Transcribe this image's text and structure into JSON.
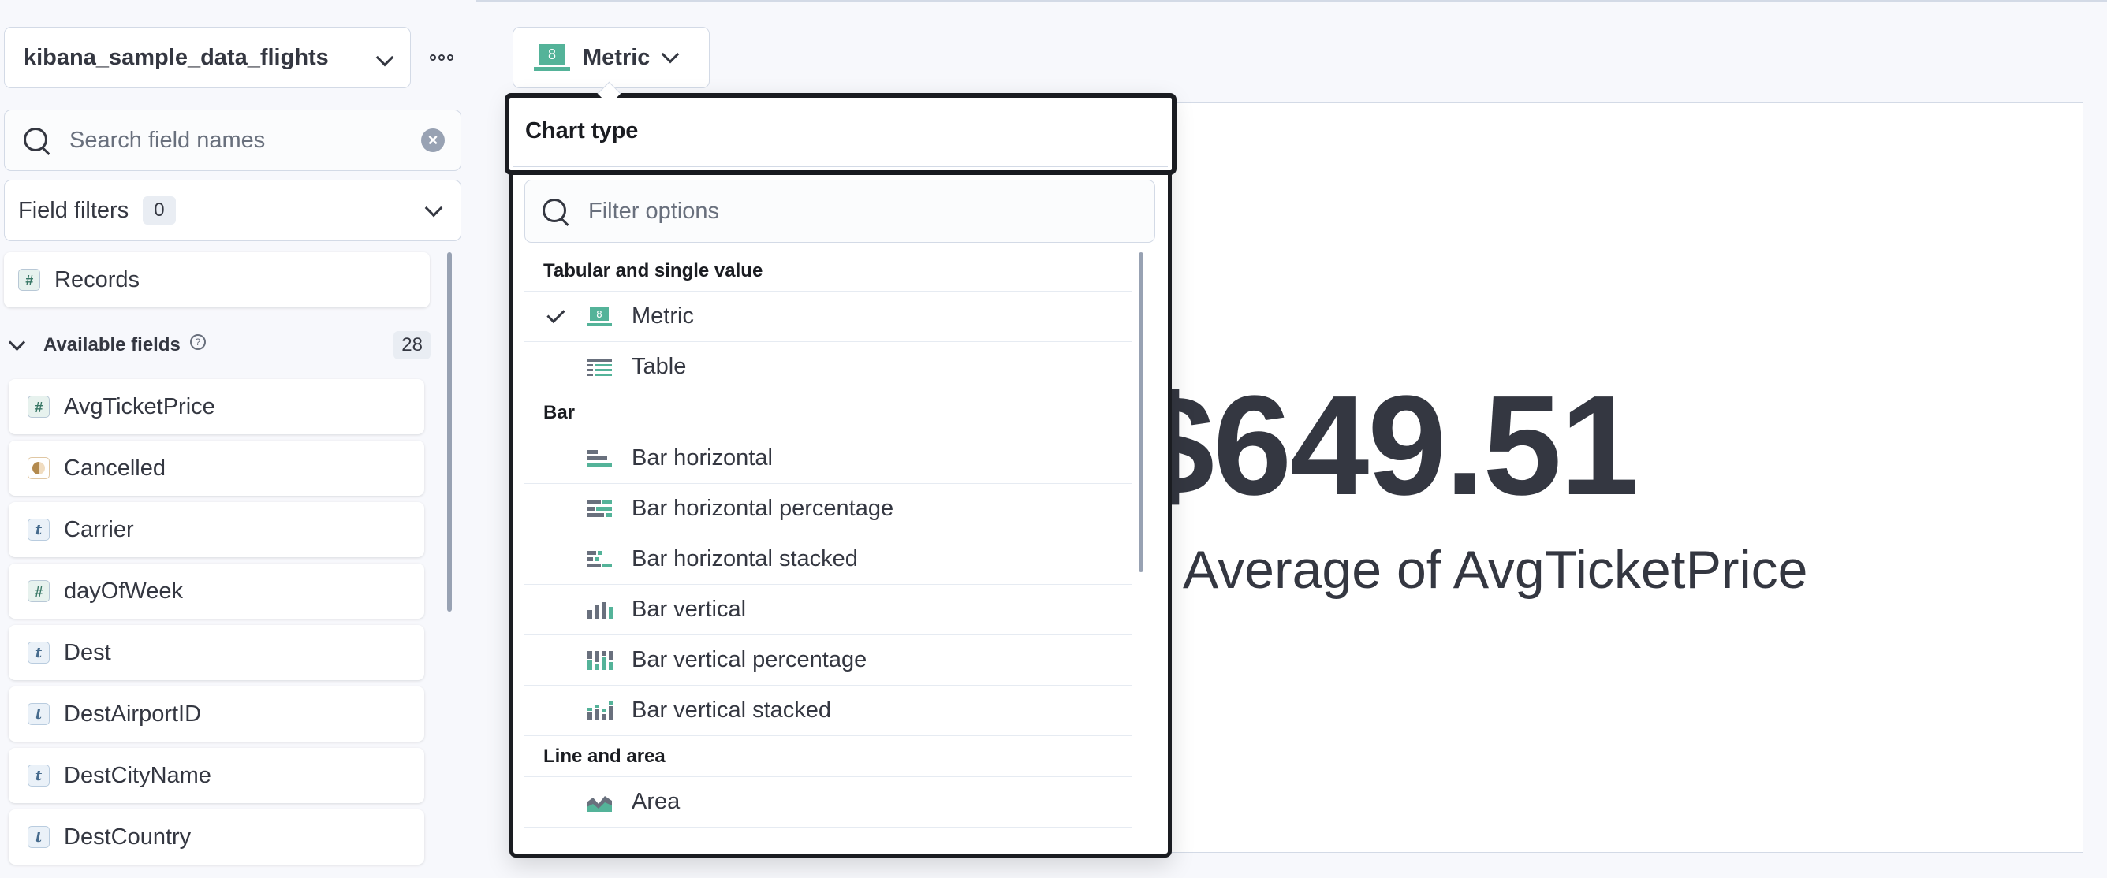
{
  "sidebar": {
    "data_view": "kibana_sample_data_flights",
    "search": {
      "placeholder": "Search field names"
    },
    "field_filters": {
      "label": "Field filters",
      "count": "0"
    },
    "records_label": "Records",
    "available": {
      "label": "Available fields",
      "count": "28"
    },
    "fields": [
      {
        "name": "AvgTicketPrice",
        "type": "#"
      },
      {
        "name": "Cancelled",
        "type": "bool"
      },
      {
        "name": "Carrier",
        "type": "t"
      },
      {
        "name": "dayOfWeek",
        "type": "#"
      },
      {
        "name": "Dest",
        "type": "t"
      },
      {
        "name": "DestAirportID",
        "type": "t"
      },
      {
        "name": "DestCityName",
        "type": "t"
      },
      {
        "name": "DestCountry",
        "type": "t"
      }
    ]
  },
  "chart_switch": {
    "label": "Metric",
    "icon_digit": "8"
  },
  "popover": {
    "title": "Chart type",
    "filter": {
      "placeholder": "Filter options"
    },
    "groups": [
      {
        "title": "Tabular and single value",
        "options": [
          {
            "label": "Metric",
            "icon": "metric-icon",
            "selected": true
          },
          {
            "label": "Table",
            "icon": "table-icon",
            "selected": false
          }
        ]
      },
      {
        "title": "Bar",
        "options": [
          {
            "label": "Bar horizontal",
            "icon": "bar-horizontal-icon",
            "selected": false
          },
          {
            "label": "Bar horizontal percentage",
            "icon": "bar-horizontal-percentage-icon",
            "selected": false
          },
          {
            "label": "Bar horizontal stacked",
            "icon": "bar-horizontal-stacked-icon",
            "selected": false
          },
          {
            "label": "Bar vertical",
            "icon": "bar-vertical-icon",
            "selected": false
          },
          {
            "label": "Bar vertical percentage",
            "icon": "bar-vertical-percentage-icon",
            "selected": false
          },
          {
            "label": "Bar vertical stacked",
            "icon": "bar-vertical-stacked-icon",
            "selected": false
          }
        ]
      },
      {
        "title": "Line and area",
        "options": [
          {
            "label": "Area",
            "icon": "area-icon",
            "selected": false
          }
        ]
      }
    ]
  },
  "metric": {
    "value": "$649.51",
    "label": "Average of AvgTicketPrice"
  },
  "colors": {
    "accent": "#54b399",
    "text": "#343741",
    "subdued": "#69707d"
  }
}
